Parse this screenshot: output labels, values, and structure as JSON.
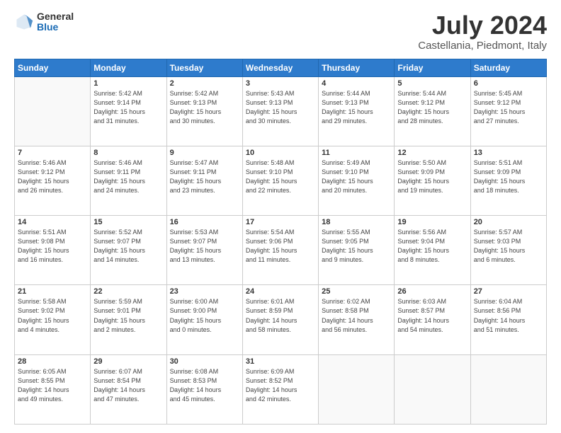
{
  "logo": {
    "general": "General",
    "blue": "Blue"
  },
  "title": "July 2024",
  "subtitle": "Castellania, Piedmont, Italy",
  "days_header": [
    "Sunday",
    "Monday",
    "Tuesday",
    "Wednesday",
    "Thursday",
    "Friday",
    "Saturday"
  ],
  "weeks": [
    [
      {
        "num": "",
        "info": ""
      },
      {
        "num": "1",
        "info": "Sunrise: 5:42 AM\nSunset: 9:14 PM\nDaylight: 15 hours\nand 31 minutes."
      },
      {
        "num": "2",
        "info": "Sunrise: 5:42 AM\nSunset: 9:13 PM\nDaylight: 15 hours\nand 30 minutes."
      },
      {
        "num": "3",
        "info": "Sunrise: 5:43 AM\nSunset: 9:13 PM\nDaylight: 15 hours\nand 30 minutes."
      },
      {
        "num": "4",
        "info": "Sunrise: 5:44 AM\nSunset: 9:13 PM\nDaylight: 15 hours\nand 29 minutes."
      },
      {
        "num": "5",
        "info": "Sunrise: 5:44 AM\nSunset: 9:12 PM\nDaylight: 15 hours\nand 28 minutes."
      },
      {
        "num": "6",
        "info": "Sunrise: 5:45 AM\nSunset: 9:12 PM\nDaylight: 15 hours\nand 27 minutes."
      }
    ],
    [
      {
        "num": "7",
        "info": "Sunrise: 5:46 AM\nSunset: 9:12 PM\nDaylight: 15 hours\nand 26 minutes."
      },
      {
        "num": "8",
        "info": "Sunrise: 5:46 AM\nSunset: 9:11 PM\nDaylight: 15 hours\nand 24 minutes."
      },
      {
        "num": "9",
        "info": "Sunrise: 5:47 AM\nSunset: 9:11 PM\nDaylight: 15 hours\nand 23 minutes."
      },
      {
        "num": "10",
        "info": "Sunrise: 5:48 AM\nSunset: 9:10 PM\nDaylight: 15 hours\nand 22 minutes."
      },
      {
        "num": "11",
        "info": "Sunrise: 5:49 AM\nSunset: 9:10 PM\nDaylight: 15 hours\nand 20 minutes."
      },
      {
        "num": "12",
        "info": "Sunrise: 5:50 AM\nSunset: 9:09 PM\nDaylight: 15 hours\nand 19 minutes."
      },
      {
        "num": "13",
        "info": "Sunrise: 5:51 AM\nSunset: 9:09 PM\nDaylight: 15 hours\nand 18 minutes."
      }
    ],
    [
      {
        "num": "14",
        "info": "Sunrise: 5:51 AM\nSunset: 9:08 PM\nDaylight: 15 hours\nand 16 minutes."
      },
      {
        "num": "15",
        "info": "Sunrise: 5:52 AM\nSunset: 9:07 PM\nDaylight: 15 hours\nand 14 minutes."
      },
      {
        "num": "16",
        "info": "Sunrise: 5:53 AM\nSunset: 9:07 PM\nDaylight: 15 hours\nand 13 minutes."
      },
      {
        "num": "17",
        "info": "Sunrise: 5:54 AM\nSunset: 9:06 PM\nDaylight: 15 hours\nand 11 minutes."
      },
      {
        "num": "18",
        "info": "Sunrise: 5:55 AM\nSunset: 9:05 PM\nDaylight: 15 hours\nand 9 minutes."
      },
      {
        "num": "19",
        "info": "Sunrise: 5:56 AM\nSunset: 9:04 PM\nDaylight: 15 hours\nand 8 minutes."
      },
      {
        "num": "20",
        "info": "Sunrise: 5:57 AM\nSunset: 9:03 PM\nDaylight: 15 hours\nand 6 minutes."
      }
    ],
    [
      {
        "num": "21",
        "info": "Sunrise: 5:58 AM\nSunset: 9:02 PM\nDaylight: 15 hours\nand 4 minutes."
      },
      {
        "num": "22",
        "info": "Sunrise: 5:59 AM\nSunset: 9:01 PM\nDaylight: 15 hours\nand 2 minutes."
      },
      {
        "num": "23",
        "info": "Sunrise: 6:00 AM\nSunset: 9:00 PM\nDaylight: 15 hours\nand 0 minutes."
      },
      {
        "num": "24",
        "info": "Sunrise: 6:01 AM\nSunset: 8:59 PM\nDaylight: 14 hours\nand 58 minutes."
      },
      {
        "num": "25",
        "info": "Sunrise: 6:02 AM\nSunset: 8:58 PM\nDaylight: 14 hours\nand 56 minutes."
      },
      {
        "num": "26",
        "info": "Sunrise: 6:03 AM\nSunset: 8:57 PM\nDaylight: 14 hours\nand 54 minutes."
      },
      {
        "num": "27",
        "info": "Sunrise: 6:04 AM\nSunset: 8:56 PM\nDaylight: 14 hours\nand 51 minutes."
      }
    ],
    [
      {
        "num": "28",
        "info": "Sunrise: 6:05 AM\nSunset: 8:55 PM\nDaylight: 14 hours\nand 49 minutes."
      },
      {
        "num": "29",
        "info": "Sunrise: 6:07 AM\nSunset: 8:54 PM\nDaylight: 14 hours\nand 47 minutes."
      },
      {
        "num": "30",
        "info": "Sunrise: 6:08 AM\nSunset: 8:53 PM\nDaylight: 14 hours\nand 45 minutes."
      },
      {
        "num": "31",
        "info": "Sunrise: 6:09 AM\nSunset: 8:52 PM\nDaylight: 14 hours\nand 42 minutes."
      },
      {
        "num": "",
        "info": ""
      },
      {
        "num": "",
        "info": ""
      },
      {
        "num": "",
        "info": ""
      }
    ]
  ]
}
